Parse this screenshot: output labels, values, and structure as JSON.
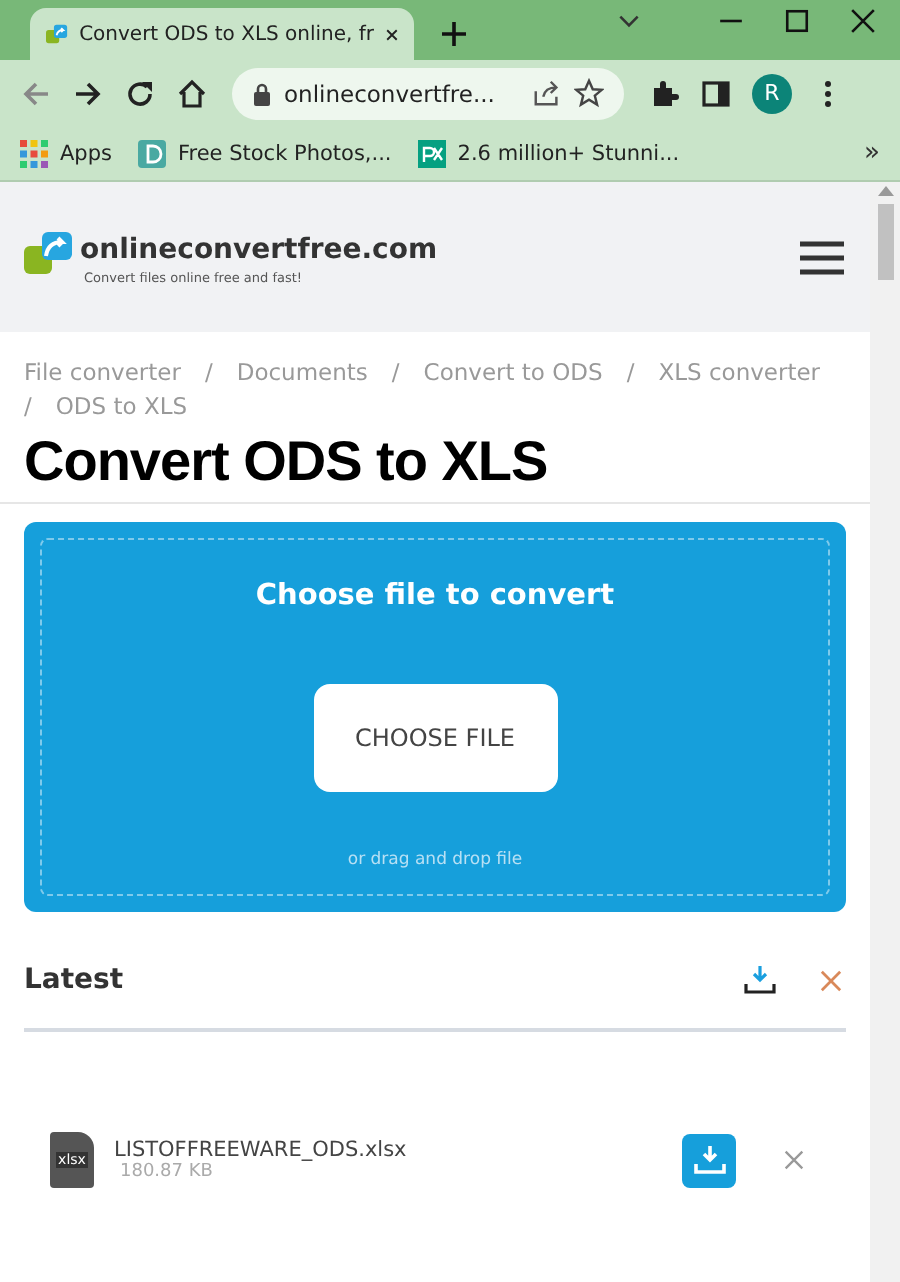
{
  "browser": {
    "tab_title": "Convert ODS to XLS online, fr",
    "address": "onlineconvertfre...",
    "profile_initial": "R",
    "bookmarks": [
      {
        "label": "Apps",
        "kind": "apps"
      },
      {
        "label": "Free Stock Photos,...",
        "kind": "d"
      },
      {
        "label": "2.6 million+ Stunni...",
        "kind": "px"
      }
    ],
    "bookmarks_overflow": "»"
  },
  "site": {
    "name": "onlineconvertfree.com",
    "tagline": "Convert files online free and fast!"
  },
  "breadcrumbs": [
    {
      "label": "File converter",
      "separator": "/"
    },
    {
      "label": "Documents",
      "separator": "/"
    },
    {
      "label": "Convert to ODS",
      "separator": "/"
    },
    {
      "label": "XLS converter",
      "separator": "/"
    },
    {
      "label": "ODS to XLS"
    }
  ],
  "title": "Convert ODS to XLS",
  "upload": {
    "heading": "Choose file to convert",
    "button": "CHOOSE FILE",
    "hint": "or drag and drop file"
  },
  "latest": {
    "heading": "Latest",
    "files": [
      {
        "name": "LISTOFFREEWARE_ODS.xlsx",
        "size": "180.87 KB",
        "type": "xlsx"
      }
    ]
  }
}
